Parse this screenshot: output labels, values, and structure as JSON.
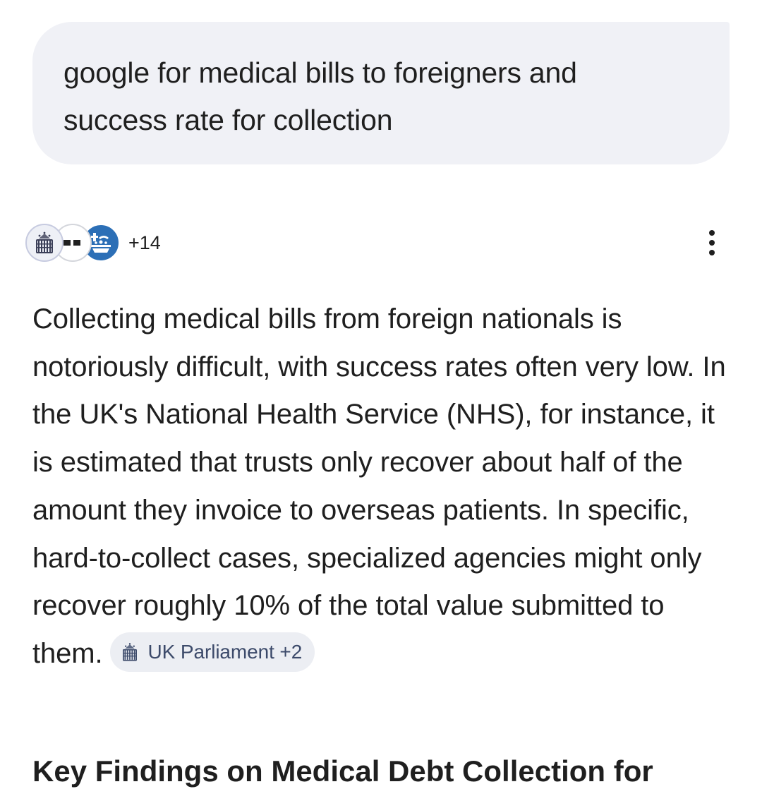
{
  "query": {
    "line1": "google for medical bills to foreigners and",
    "line2": "success rate for collection"
  },
  "sources": {
    "icons": [
      "uk-parliament-icon",
      "source-dots-icon",
      "nhs-icon"
    ],
    "more_count": "+14"
  },
  "answer": {
    "body": "Collecting medical bills from foreign nationals is notoriously difficult, with success rates often very low. In the UK's National Health Service (NHS), for instance, it is estimated that trusts only recover about half of the amount they invoice to overseas patients. In specific, hard-to-collect cases, specialized agencies might only recover roughly 10% of the total value submitted to",
    "tail": "them.",
    "citation_chip": {
      "icon": "uk-parliament-icon",
      "label": "UK Parliament +2"
    }
  },
  "next_heading": "Key Findings on Medical Debt Collection for",
  "colors": {
    "bubble_bg": "#f0f1f6",
    "chip_bg": "#eceef3",
    "chip_text": "#3c4a6a",
    "nhs_blue": "#2c6fb6",
    "text": "#1f1f1f"
  }
}
